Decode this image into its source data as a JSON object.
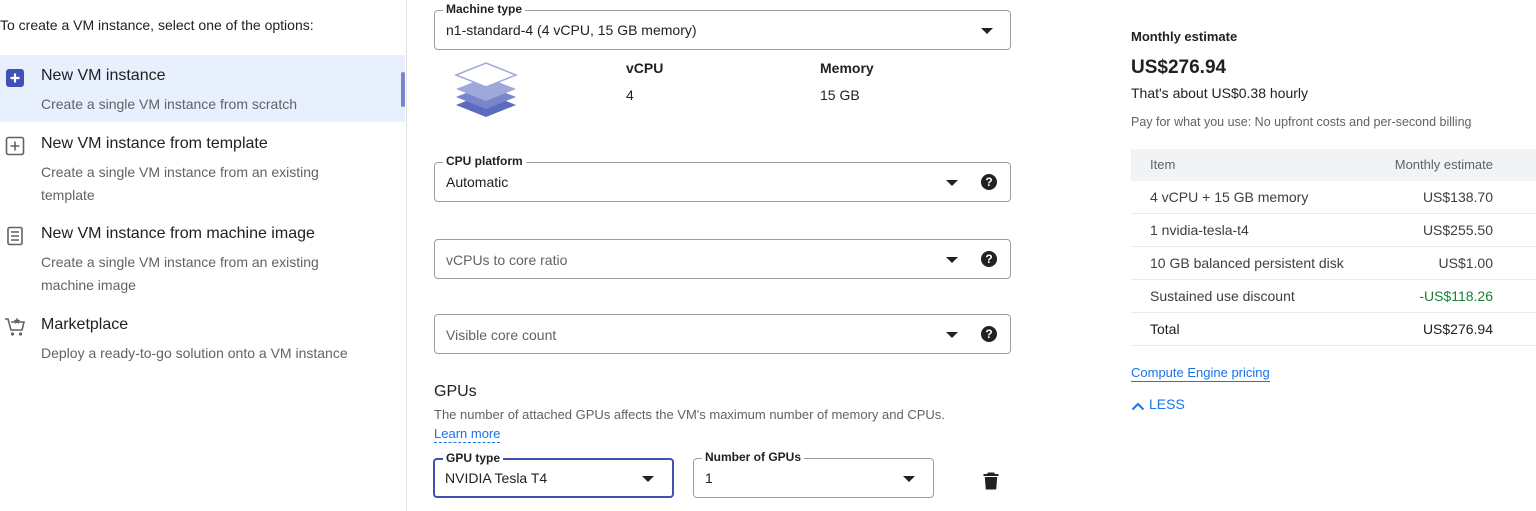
{
  "left": {
    "intro": "To create a VM instance, select one of the options:",
    "options": [
      {
        "title": "New VM instance",
        "desc": "Create a single VM instance from scratch",
        "icon": "add-box-icon",
        "selected": true
      },
      {
        "title": "New VM instance from template",
        "desc": "Create a single VM instance from an existing template",
        "icon": "add-box-outline-icon",
        "selected": false
      },
      {
        "title": "New VM instance from machine image",
        "desc": "Create a single VM instance from an existing machine image",
        "icon": "machine-image-icon",
        "selected": false
      },
      {
        "title": "Marketplace",
        "desc": "Deploy a ready-to-go solution onto a VM instance",
        "icon": "marketplace-cart-icon",
        "selected": false
      }
    ]
  },
  "form": {
    "machine_type": {
      "label": "Machine type",
      "value": "n1-standard-4 (4 vCPU, 15 GB memory)"
    },
    "specs": {
      "vcpu_label": "vCPU",
      "vcpu_value": "4",
      "memory_label": "Memory",
      "memory_value": "15 GB"
    },
    "cpu_platform": {
      "label": "CPU platform",
      "value": "Automatic"
    },
    "vcpu_ratio": {
      "placeholder": "vCPUs to core ratio"
    },
    "core_count": {
      "placeholder": "Visible core count"
    },
    "gpus": {
      "title": "GPUs",
      "desc": "The number of attached GPUs affects the VM's maximum number of memory and CPUs.",
      "learn_more": "Learn more",
      "gpu_type": {
        "label": "GPU type",
        "value": "NVIDIA Tesla T4"
      },
      "gpu_count": {
        "label": "Number of GPUs",
        "value": "1"
      }
    }
  },
  "estimate": {
    "label": "Monthly estimate",
    "price": "US$276.94",
    "hourly": "That's about US$0.38 hourly",
    "note": "Pay for what you use: No upfront costs and per-second billing",
    "table": {
      "head": {
        "item": "Item",
        "cost": "Monthly estimate"
      },
      "rows": [
        {
          "item": "4 vCPU + 15 GB memory",
          "cost": "US$138.70"
        },
        {
          "item": "1 nvidia-tesla-t4",
          "cost": "US$255.50"
        },
        {
          "item": "10 GB balanced persistent disk",
          "cost": "US$1.00"
        },
        {
          "item": "Sustained use discount",
          "cost": "-US$118.26"
        }
      ],
      "total": {
        "item": "Total",
        "cost": "US$276.94"
      }
    },
    "pricing_link": "Compute Engine pricing",
    "less": "LESS"
  },
  "colors": {
    "accent": "#1a73e8",
    "selected_bg": "#e8f0fe",
    "focus": "#3f51b5",
    "discount": "#188038"
  }
}
